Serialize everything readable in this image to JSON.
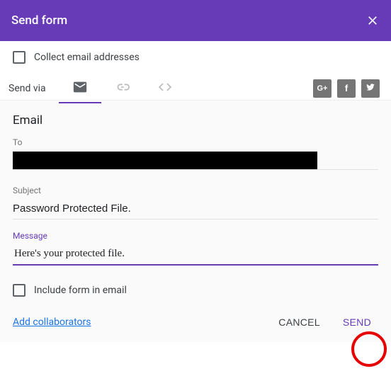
{
  "header": {
    "title": "Send form"
  },
  "collect": {
    "label": "Collect email addresses"
  },
  "sendvia": {
    "label": "Send via"
  },
  "social": {
    "gplus": "G+",
    "fb": "f",
    "tw": "t"
  },
  "email": {
    "heading": "Email",
    "to_label": "To",
    "subject_label": "Subject",
    "subject_value": "Password Protected File.",
    "message_label": "Message",
    "message_value": "Here's your protected file.",
    "include_label": "Include form in email"
  },
  "footer": {
    "add_collab": "Add collaborators",
    "cancel": "CANCEL",
    "send": "SEND"
  }
}
